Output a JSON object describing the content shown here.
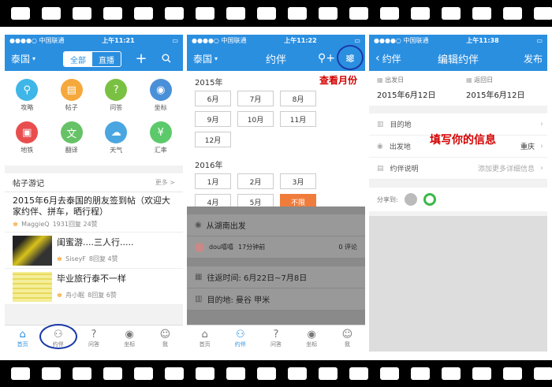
{
  "status": {
    "carrier": "●●●●○ 中国联通",
    "battery": "▭"
  },
  "screen1": {
    "time": "上午11:21",
    "city": "泰国",
    "seg_all": "全部",
    "seg_live": "直播",
    "grid": [
      {
        "label": "攻略",
        "color": "#3fb6e8",
        "icon": "pin-icon"
      },
      {
        "label": "帖子",
        "color": "#f5a83c",
        "icon": "note-icon"
      },
      {
        "label": "问答",
        "color": "#7ac143",
        "icon": "question-icon"
      },
      {
        "label": "坐标",
        "color": "#4a90d9",
        "icon": "location-icon"
      },
      {
        "label": "地铁",
        "color": "#e94e4e",
        "icon": "subway-icon"
      },
      {
        "label": "翻译",
        "color": "#66c266",
        "icon": "translate-icon"
      },
      {
        "label": "天气",
        "color": "#4aa6e0",
        "icon": "weather-icon"
      },
      {
        "label": "汇率",
        "color": "#5cc96a",
        "icon": "currency-icon"
      }
    ],
    "section_title": "帖子游记",
    "section_more": "更多 >",
    "posts": [
      {
        "title": "2015年6月去泰国的朋友签到帖（欢迎大家约伴、拼车，晒行程）",
        "user": "MaggieQ",
        "stats": "1931回复 24赞"
      },
      {
        "title": "闺蜜游....三人行.....",
        "user": "SiseyF",
        "stats": "8回复 4赞"
      },
      {
        "title": "毕业旅行泰不一样",
        "user": "舟小眠",
        "stats": "8回复 6赞"
      }
    ],
    "tabs": [
      "首页",
      "约伴",
      "问答",
      "坐标",
      "我"
    ]
  },
  "screen2": {
    "time": "上午11:22",
    "city": "泰国",
    "title": "约伴",
    "year1": "2015年",
    "months1": [
      "6月",
      "7月",
      "8月",
      "9月",
      "10月",
      "11月",
      "12月"
    ],
    "year2": "2016年",
    "months2": [
      "1月",
      "2月",
      "3月",
      "4月",
      "5月",
      "不限"
    ],
    "annotation": "查看月份",
    "from": "从湖南出发",
    "poster": "dou嘻嘻",
    "ago": "17分钟前",
    "comments": "0 评论",
    "dates": "往返时间:  6月22日~7月8日",
    "dest": "目的地:  曼谷  甲米",
    "tabs": [
      "首页",
      "约伴",
      "问答",
      "坐标",
      "我"
    ]
  },
  "screen3": {
    "time": "上午11:38",
    "back": "约伴",
    "title": "编辑约伴",
    "publish": "发布",
    "depart_label": "出发日",
    "depart_date": "2015年6月12日",
    "return_label": "返回日",
    "return_date": "2015年6月12日",
    "dest_label": "目的地",
    "origin_label": "出发地",
    "origin_value": "重庆",
    "desc_label": "约伴说明",
    "desc_placeholder": "添加更多详细信息",
    "annotation": "填写你的信息",
    "share_label": "分享到:"
  }
}
